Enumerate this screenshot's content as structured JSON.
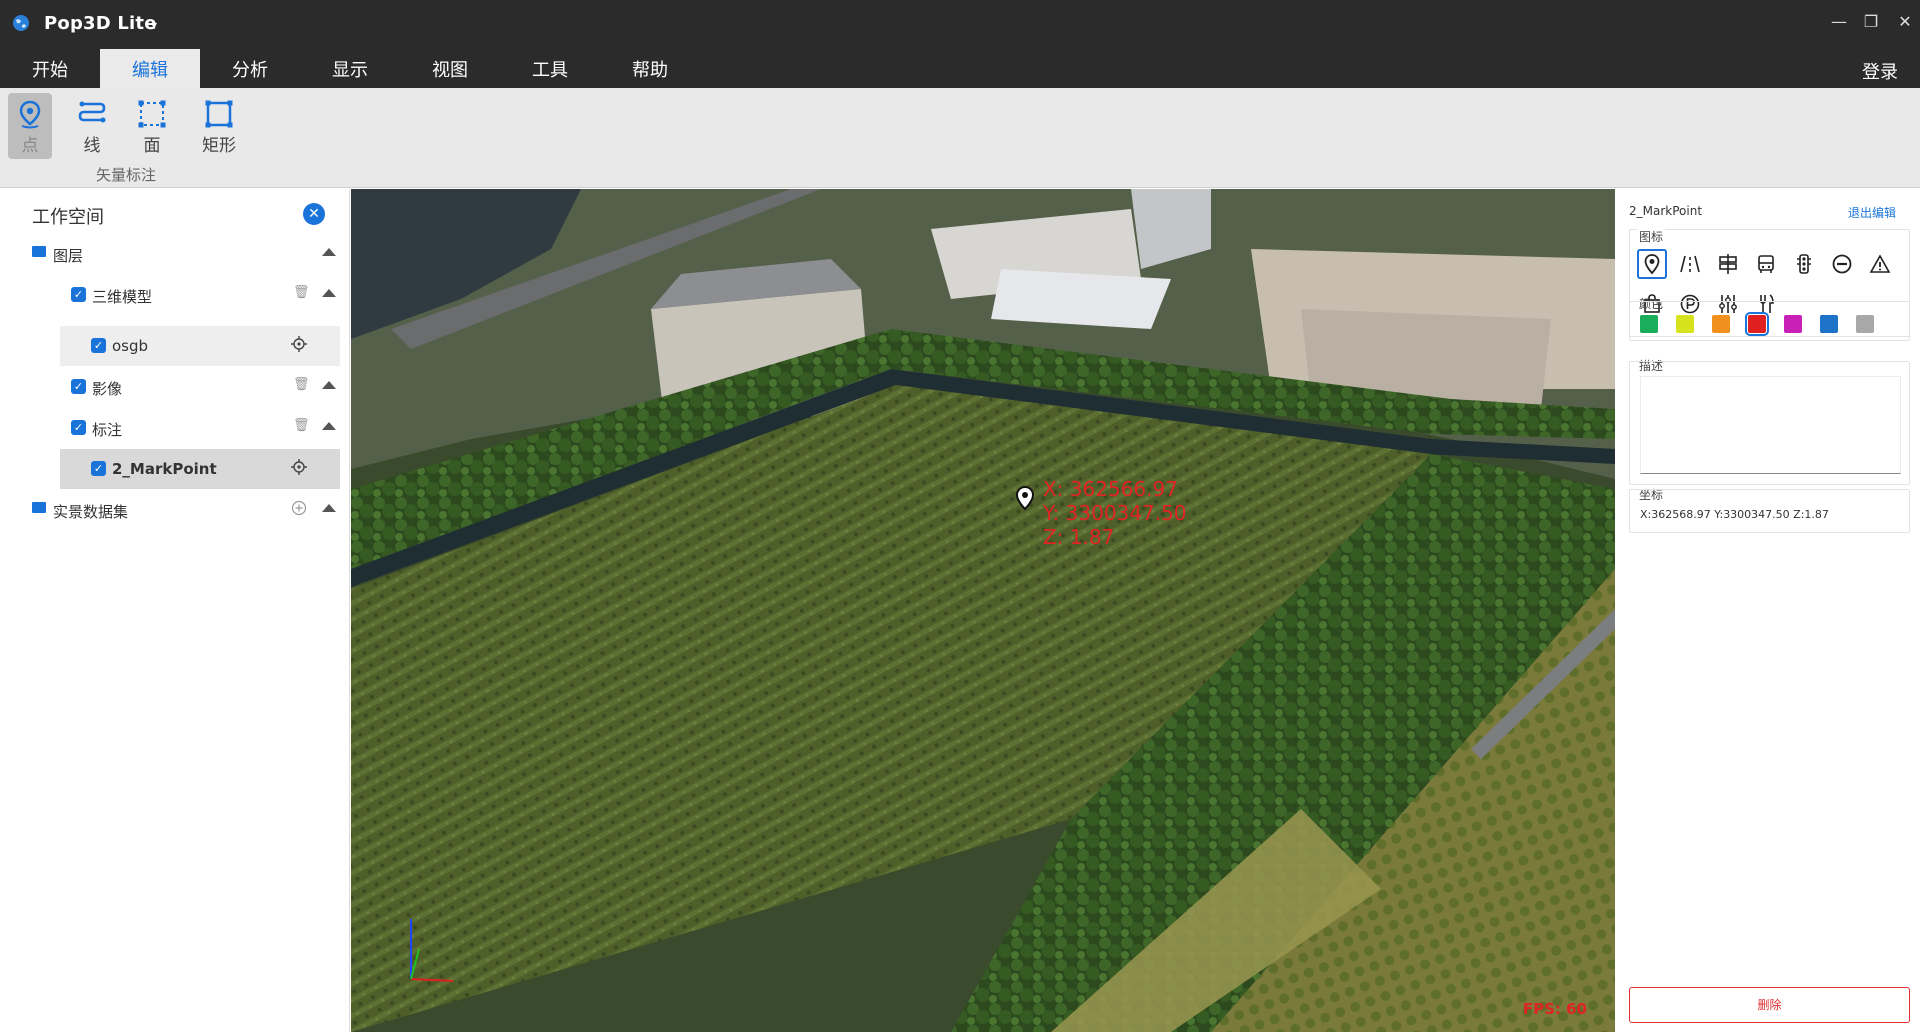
{
  "app": {
    "title": "Pop3D Lite",
    "menu_caret": "▾",
    "login": "登录"
  },
  "window_controls": {
    "minimize": "—",
    "restore": "❐",
    "close": "✕"
  },
  "menu_tabs": [
    {
      "label": "开始"
    },
    {
      "label": "编辑",
      "active": true
    },
    {
      "label": "分析"
    },
    {
      "label": "显示"
    },
    {
      "label": "视图"
    },
    {
      "label": "工具"
    },
    {
      "label": "帮助"
    }
  ],
  "ribbon": {
    "tools": [
      {
        "label": "点",
        "icon": "map-pin-icon",
        "active": true
      },
      {
        "label": "线",
        "icon": "polyline-icon"
      },
      {
        "label": "面",
        "icon": "polygon-icon"
      },
      {
        "label": "矩形",
        "icon": "rectangle-icon"
      }
    ],
    "group_label": "矢量标注"
  },
  "workspace": {
    "title": "工作空间",
    "close_icon": "close-icon",
    "tree": [
      {
        "label": "图层",
        "level": 0,
        "type": "folder"
      },
      {
        "label": "三维模型",
        "level": 1,
        "checked": true
      },
      {
        "label": "osgb",
        "level": 2,
        "checked": true
      },
      {
        "label": "影像",
        "level": 1,
        "checked": true
      },
      {
        "label": "标注",
        "level": 1,
        "checked": true
      },
      {
        "label": "2_MarkPoint",
        "level": 2,
        "checked": true,
        "selected": true
      },
      {
        "label": "实景数据集",
        "level": 0,
        "type": "folder"
      }
    ]
  },
  "viewport": {
    "mark_label": {
      "x": "X: 362566.97",
      "y": "Y: 3300347.50",
      "z": "Z: 1.87"
    },
    "fps": "FPS: 60"
  },
  "editor": {
    "title": "2_MarkPoint",
    "exit_label": "退出编辑",
    "icon_section": "图标",
    "icons": [
      "map-pin-icon",
      "road-icon",
      "signpost-icon",
      "bus-icon",
      "traffic-light-icon",
      "no-entry-icon",
      "warning-icon",
      "shopping-bag-icon",
      "parking-icon",
      "sliders-icon",
      "utensils-icon"
    ],
    "color_section": "颜色",
    "colors": [
      "#1aae5b",
      "#d6e21c",
      "#f0901e",
      "#e02020",
      "#c81fb6",
      "#1e72c8",
      "#a8a8a8"
    ],
    "selected_color_index": 3,
    "desc_section": "描述",
    "desc_value": "",
    "coord_section": "坐标",
    "coords": "X:362568.97   Y:3300347.50   Z:1.87",
    "delete_label": "删除"
  }
}
